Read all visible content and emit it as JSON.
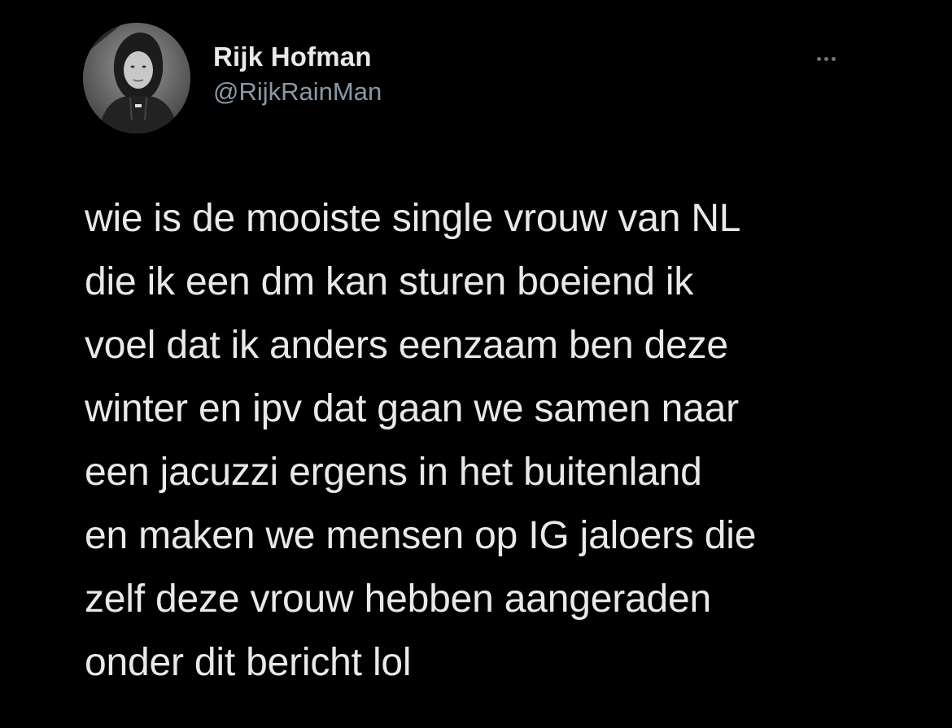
{
  "author": {
    "display_name": "Rijk Hofman",
    "handle": "@RijkRainMan",
    "avatar_icon": "profile-photo-hooded-person"
  },
  "more_icon": "more-dots-icon",
  "tweet": {
    "lines": [
      "wie is de mooiste single vrouw van NL",
      "die ik een dm kan sturen boeiend ik",
      "voel dat ik anders eenzaam ben deze",
      "winter en ipv dat gaan we samen naar",
      "een jacuzzi ergens in het buitenland",
      "en maken we mensen op IG jaloers die",
      "zelf deze vrouw hebben aangeraden",
      "onder dit bericht lol"
    ]
  },
  "colors": {
    "background": "#000000",
    "text": "#e7e9ea",
    "secondary_text": "#8b98a5"
  }
}
